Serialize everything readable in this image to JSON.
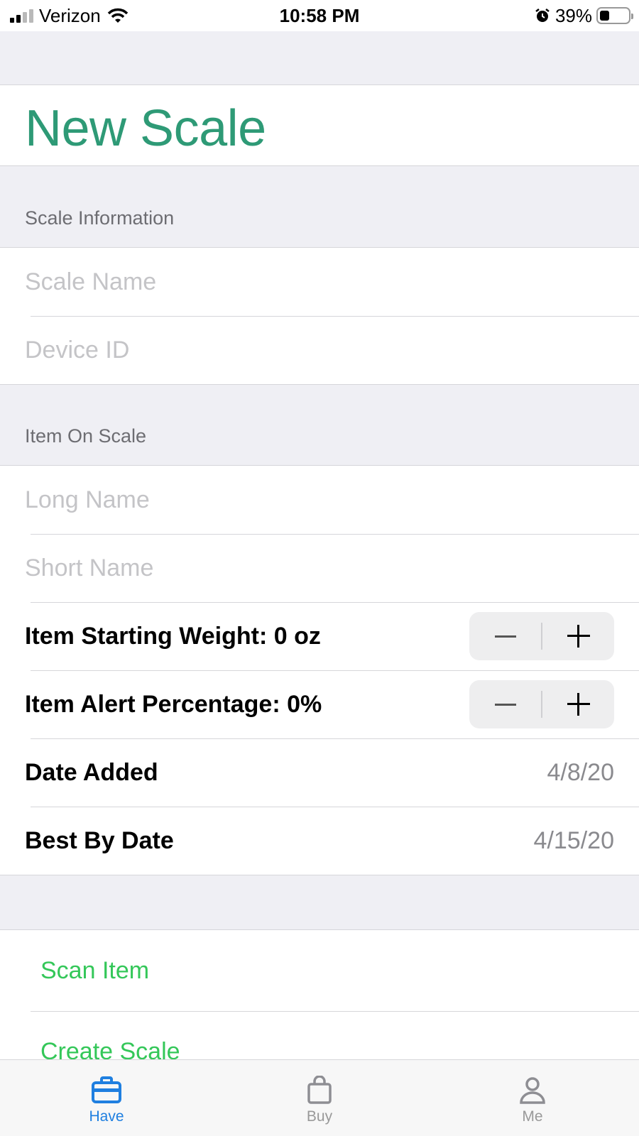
{
  "status_bar": {
    "carrier": "Verizon",
    "time": "10:58 PM",
    "battery_percent": "39%"
  },
  "page": {
    "title": "New Scale"
  },
  "sections": {
    "scale_info_header": "Scale Information",
    "item_header": "Item On Scale"
  },
  "fields": {
    "scale_name_placeholder": "Scale Name",
    "device_id_placeholder": "Device ID",
    "long_name_placeholder": "Long Name",
    "short_name_placeholder": "Short Name"
  },
  "rows": {
    "starting_weight_label": "Item Starting Weight: 0 oz",
    "alert_percentage_label": "Item Alert Percentage: 0%",
    "date_added_label": "Date Added",
    "date_added_value": "4/8/20",
    "best_by_label": "Best By Date",
    "best_by_value": "4/15/20"
  },
  "actions": {
    "scan_item": "Scan Item",
    "create_scale": "Create Scale"
  },
  "tabs": [
    {
      "label": "Have",
      "icon": "briefcase-icon",
      "active": true
    },
    {
      "label": "Buy",
      "icon": "bag-icon",
      "active": false
    },
    {
      "label": "Me",
      "icon": "person-icon",
      "active": false
    }
  ],
  "colors": {
    "title_green": "#2e9a76",
    "action_green": "#34c759",
    "tab_active_blue": "#1f7fe0"
  }
}
